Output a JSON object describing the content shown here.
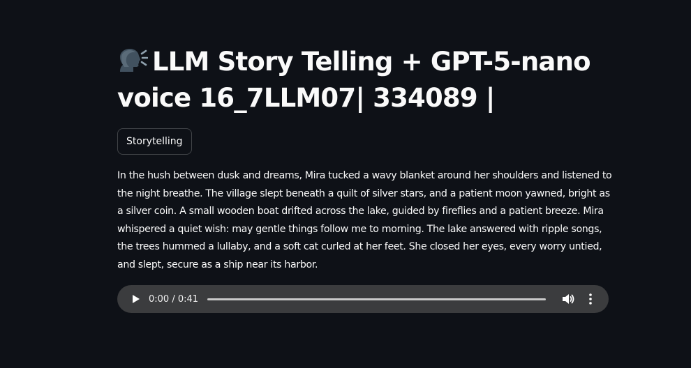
{
  "header": {
    "icon": "speaking-head-icon",
    "title": "LLM Story Telling + GPT-5-nano voice 16_7LLM07| 334089 |"
  },
  "controls": {
    "storytelling_button_label": "Storytelling"
  },
  "story": {
    "text": "In the hush between dusk and dreams, Mira tucked a wavy blanket around her shoulders and listened to the night breathe. The village slept beneath a quilt of silver stars, and a patient moon yawned, bright as a silver coin. A small wooden boat drifted across the lake, guided by fireflies and a patient breeze. Mira whispered a quiet wish: may gentle things follow me to morning. The lake answered with ripple songs, the trees hummed a lullaby, and a soft cat curled at her feet. She closed her eyes, every worry untied, and slept, secure as a ship near its harbor."
  },
  "audio_player": {
    "time_display": "0:00 / 0:41",
    "progress": 0,
    "icons": {
      "play": "play-icon",
      "volume": "volume-icon",
      "more": "more-options-icon"
    }
  },
  "colors": {
    "background": "#0e1117",
    "text": "#fafafa",
    "player_background": "#3b3c3e"
  }
}
